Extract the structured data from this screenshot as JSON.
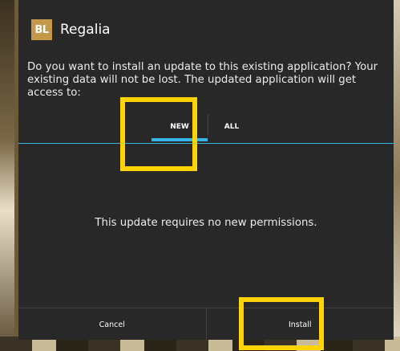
{
  "app": {
    "icon_text": "BL",
    "name": "Regalia",
    "icon_color": "#c49a4a"
  },
  "message": "Do you want to install an update to this existing application? Your existing data will not be lost. The updated application will get access to:",
  "tabs": [
    {
      "label": "NEW",
      "selected": true
    },
    {
      "label": "ALL",
      "selected": false
    }
  ],
  "permissions_text": "This update requires no new permissions.",
  "buttons": {
    "cancel": "Cancel",
    "install": "Install"
  },
  "colors": {
    "accent": "#33b5e5",
    "highlight": "#ffd400",
    "dialog_bg": "#282828"
  }
}
